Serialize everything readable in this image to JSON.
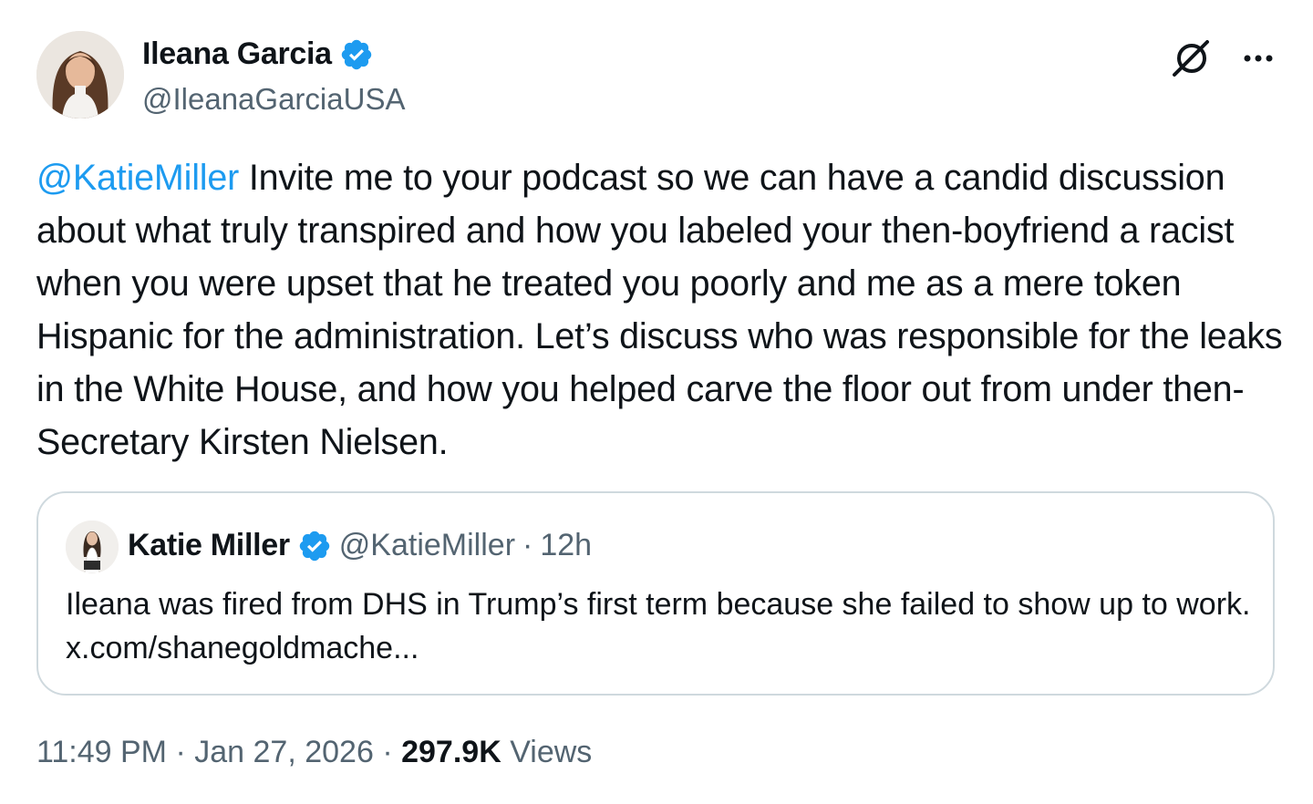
{
  "author": {
    "display_name": "Ileana Garcia",
    "handle": "@IleanaGarciaUSA",
    "verified_icon": "verified-badge-icon"
  },
  "actions": {
    "grok_icon": "grok-icon",
    "more_icon": "more-icon"
  },
  "tweet": {
    "mention": "@KatieMiller",
    "text": " Invite me to your podcast so we can have a candid discussion about what truly transpired and how you labeled your then-boyfriend a racist when you were upset that he treated you poorly and me as a mere token Hispanic for the administration. Let’s discuss who was responsible for the leaks in the White House, and how you helped carve the floor out from under then-Secretary Kirsten Nielsen."
  },
  "quote": {
    "display_name": "Katie Miller",
    "handle": "@KatieMiller",
    "separator": "·",
    "time": "12h",
    "text": "Ileana was fired from DHS in Trump’s first term because she failed to show up to work. x.com/shanegoldmache..."
  },
  "meta": {
    "time": "11:49 PM",
    "sep1": "·",
    "date": "Jan 27, 2026",
    "sep2": "·",
    "views_count": "297.9K",
    "views_label": "Views"
  },
  "colors": {
    "accent": "#1d9bf0",
    "secondary_text": "#536471",
    "primary_text": "#0f1419",
    "border": "#cfd9de"
  }
}
